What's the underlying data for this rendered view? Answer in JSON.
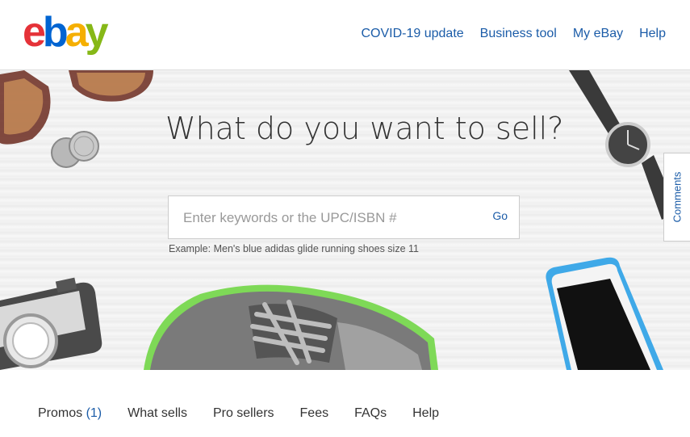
{
  "logo": {
    "letters": [
      "e",
      "b",
      "a",
      "y"
    ],
    "colors": [
      "#e53238",
      "#0064d2",
      "#f5af02",
      "#86b817"
    ]
  },
  "header_nav": {
    "items": [
      "COVID-19 update",
      "Business tool",
      "My eBay",
      "Help"
    ]
  },
  "hero": {
    "title": "What do you want to sell?",
    "search": {
      "placeholder": "Enter keywords or the UPC/ISBN #",
      "value": ""
    },
    "go_label": "Go",
    "example": "Example: Men's blue adidas glide running shoes size 11"
  },
  "comments_tab": "Comments",
  "subnav": {
    "promos_label": "Promos",
    "promos_count": "(1)",
    "items": [
      "What sells",
      "Pro sellers",
      "Fees",
      "FAQs",
      "Help"
    ]
  },
  "colors": {
    "link": "#1b5ca8",
    "text": "#333333"
  },
  "icons": [
    "sunglasses-image",
    "coins-image",
    "watch-image",
    "camera-image",
    "sneaker-image",
    "smartphone-image"
  ]
}
